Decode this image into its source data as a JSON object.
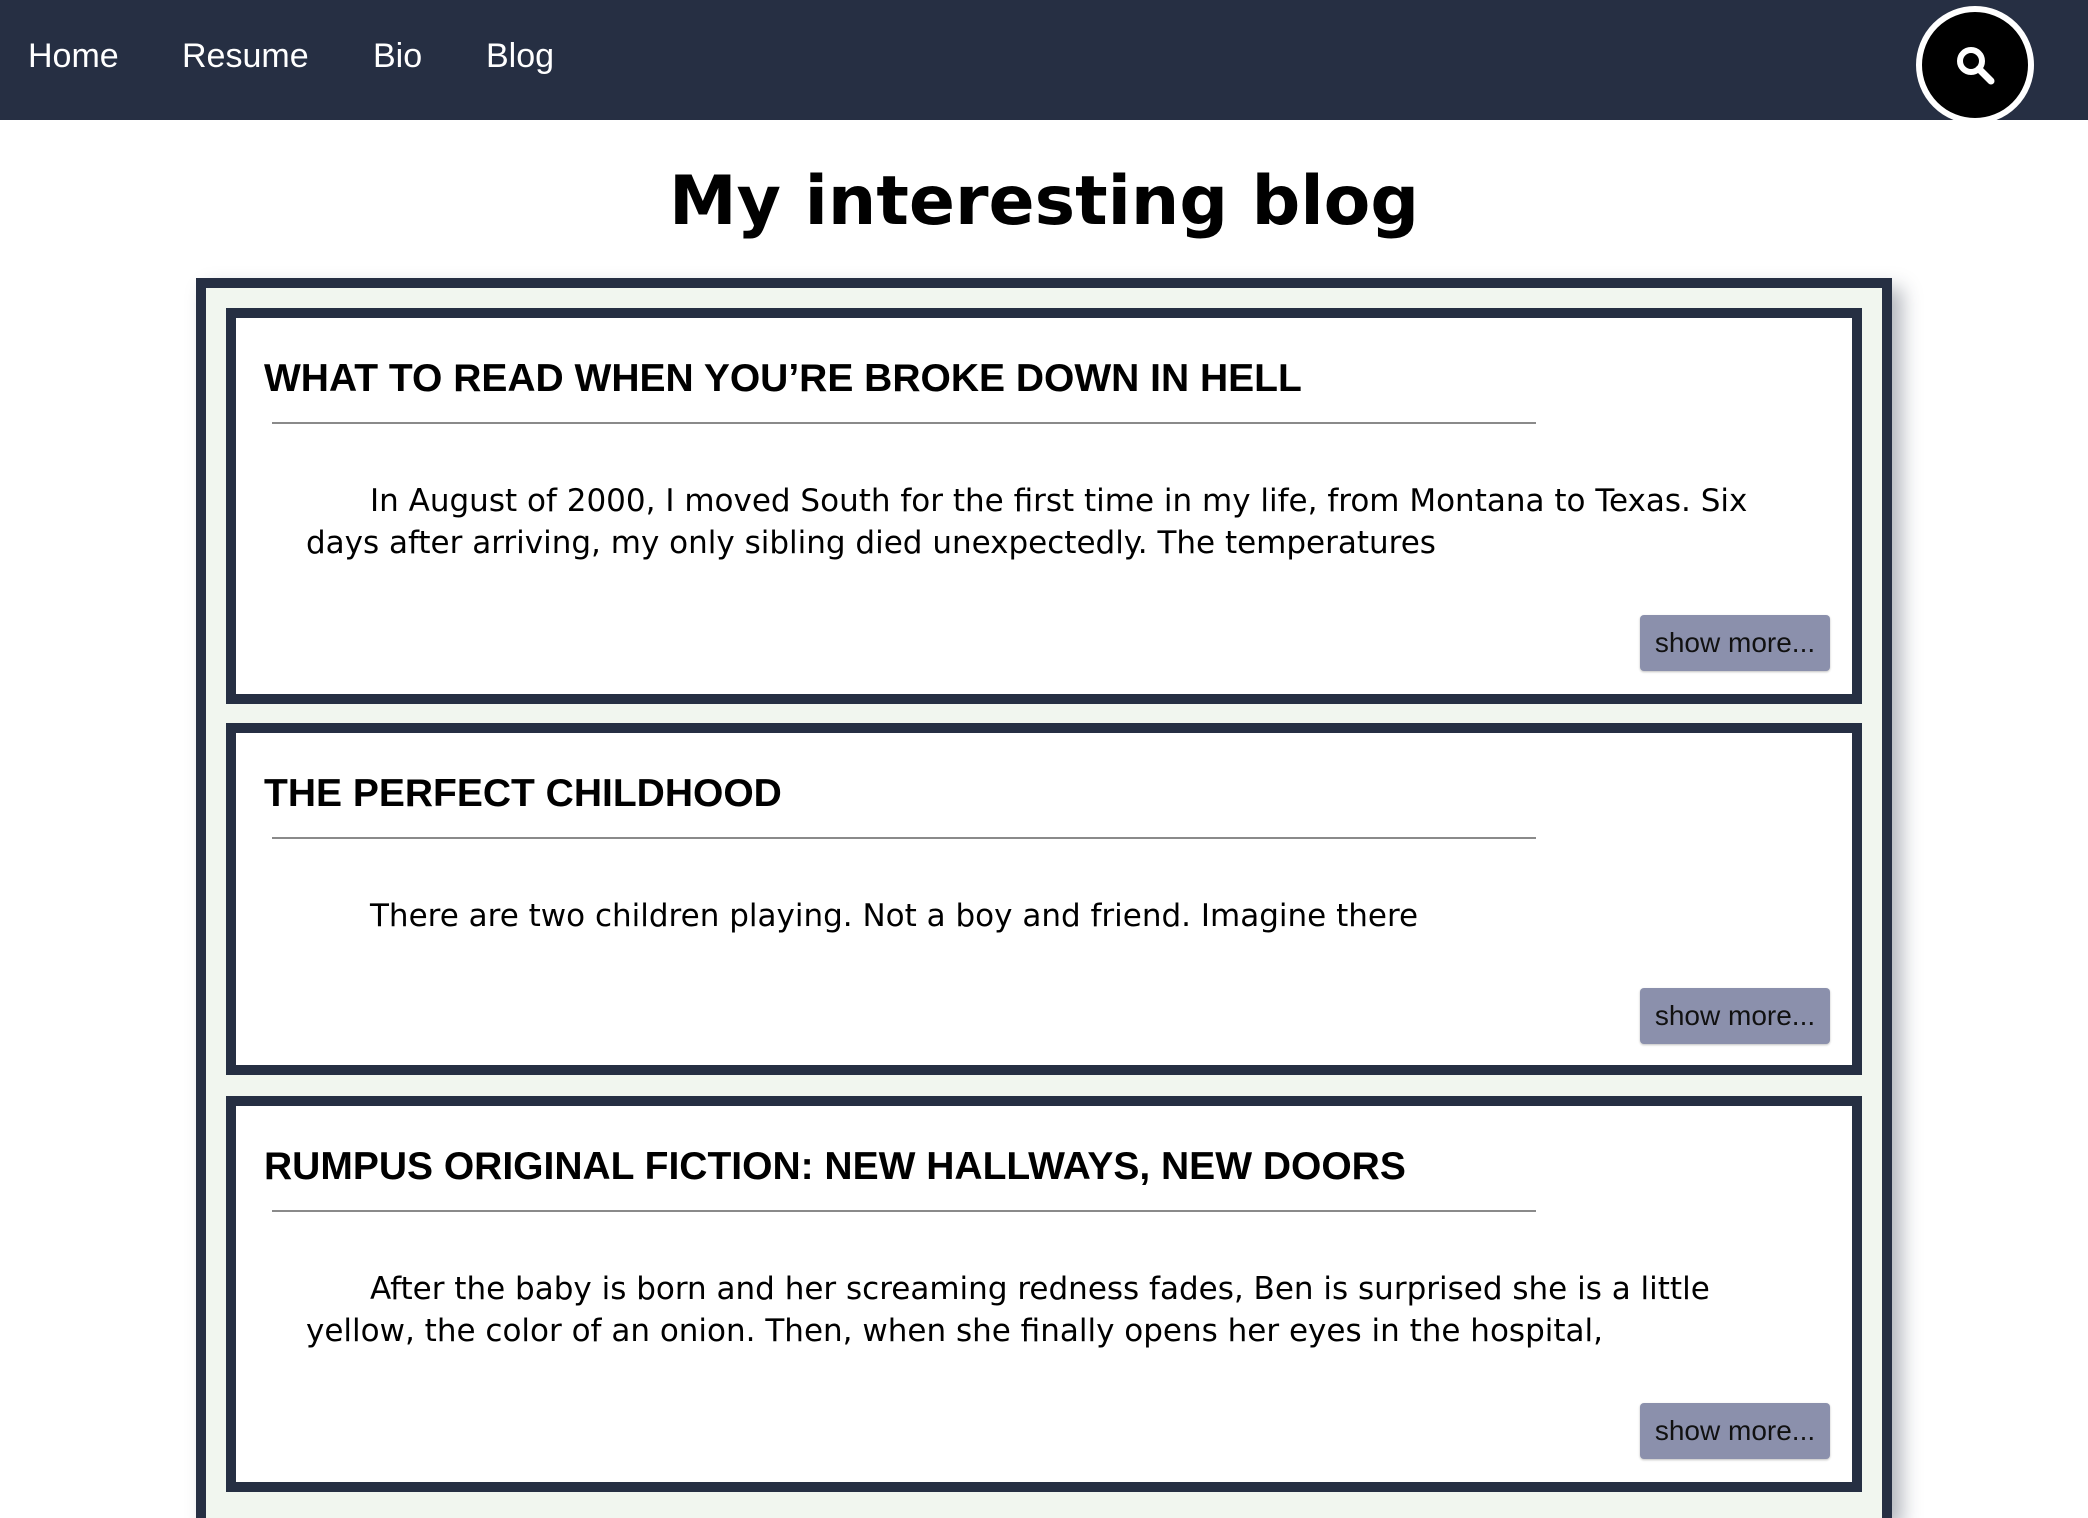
{
  "navbar": {
    "links": [
      {
        "label": "Home"
      },
      {
        "label": "Resume"
      },
      {
        "label": "Bio"
      },
      {
        "label": "Blog"
      }
    ],
    "search_icon": "search-icon"
  },
  "page": {
    "title": "My interesting blog"
  },
  "posts": [
    {
      "title": "WHAT TO READ WHEN YOU’RE BROKE DOWN IN HELL",
      "excerpt": "In August of 2000, I moved South for the first time in my life, from Montana to Texas. Six days after arriving, my only sibling died unexpectedly. The temperatures",
      "button_label": "show more..."
    },
    {
      "title": "THE PERFECT CHILDHOOD",
      "excerpt": "There are two children playing. Not a boy and friend. Imagine there",
      "button_label": "show more..."
    },
    {
      "title": "RUMPUS ORIGINAL FICTION: NEW HALLWAYS, NEW DOORS",
      "excerpt": "After the baby is born and her screaming redness fades, Ben is surprised she is a little yellow, the color of an onion. Then, when she finally opens her eyes in the hospital,",
      "button_label": "show more..."
    }
  ],
  "colors": {
    "navbar_bg": "#262f43",
    "frame_bg": "#f1f6ef",
    "card_border": "#262f43",
    "button_bg": "#8b90ac"
  }
}
